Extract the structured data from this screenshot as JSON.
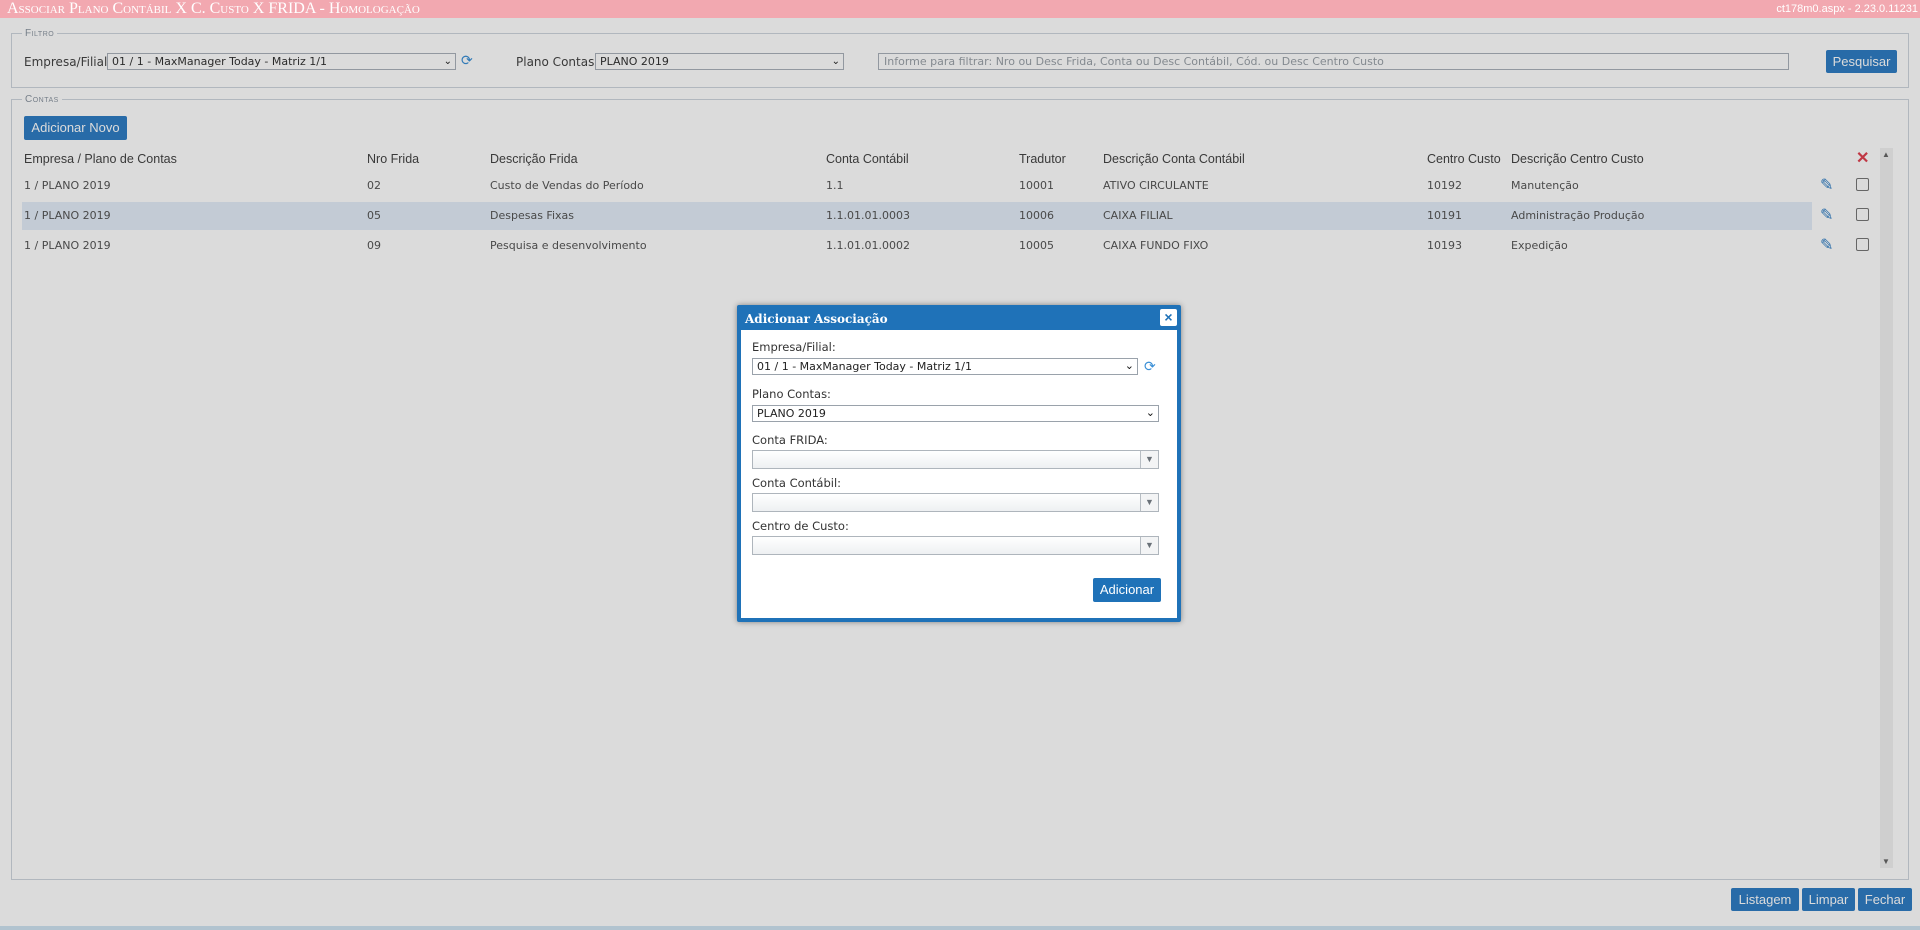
{
  "window": {
    "title": "Associar Plano Contábil X C. Custo X FRIDA  - Homologação",
    "version": "ct178m0.aspx - 2.23.0.11231"
  },
  "filter": {
    "legend": "Filtro",
    "empresa_label": "Empresa/Filial:",
    "empresa_value": "01 / 1 - MaxManager Today - Matriz 1/1",
    "plano_label": "Plano Contas:",
    "plano_value": "PLANO 2019",
    "search_placeholder": "Informe para filtrar: Nro ou Desc Frida, Conta ou Desc Contábil, Cód. ou Desc Centro Custo",
    "search_button": "Pesquisar"
  },
  "contas": {
    "legend": "Contas",
    "add_button": "Adicionar Novo",
    "columns": [
      "Empresa / Plano de Contas",
      "Nro Frida",
      "Descrição Frida",
      "Conta Contábil",
      "Tradutor",
      "Descrição Conta Contábil",
      "Centro Custo",
      "Descrição Centro Custo"
    ],
    "rows": [
      {
        "empresa": "1 / PLANO 2019",
        "nro": "02",
        "desc_frida": "Custo de Vendas do Período",
        "conta": "1.1",
        "tradutor": "10001",
        "desc_conta": "ATIVO CIRCULANTE",
        "centro": "10192",
        "desc_centro": "Manutenção"
      },
      {
        "empresa": "1 / PLANO 2019",
        "nro": "05",
        "desc_frida": "Despesas Fixas",
        "conta": "1.1.01.01.0003",
        "tradutor": "10006",
        "desc_conta": "CAIXA FILIAL",
        "centro": "10191",
        "desc_centro": "Administração Produção"
      },
      {
        "empresa": "1 / PLANO 2019",
        "nro": "09",
        "desc_frida": "Pesquisa e desenvolvimento",
        "conta": "1.1.01.01.0002",
        "tradutor": "10005",
        "desc_conta": "CAIXA FUNDO FIXO",
        "centro": "10193",
        "desc_centro": "Expedição"
      }
    ]
  },
  "footer": {
    "listagem": "Listagem",
    "limpar": "Limpar",
    "fechar": "Fechar"
  },
  "dialog": {
    "title": "Adicionar Associação",
    "close": "×",
    "empresa_label": "Empresa/Filial:",
    "empresa_value": "01 / 1 - MaxManager Today - Matriz 1/1",
    "plano_label": "Plano Contas:",
    "plano_value": "PLANO 2019",
    "frida_label": "Conta FRIDA:",
    "contabil_label": "Conta Contábil:",
    "centro_label": "Centro de Custo:",
    "add_button": "Adicionar"
  },
  "colors": {
    "title_bar": "#f2a8b0",
    "accent": "#2f7dc4",
    "delete": "#e04050"
  }
}
